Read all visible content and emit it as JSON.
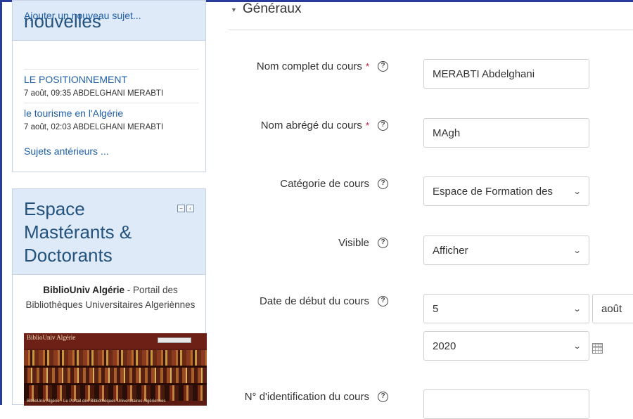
{
  "news_block": {
    "title": "nouvelles",
    "add_topic": "Ajouter un nouveau sujet...",
    "posts": [
      {
        "title": "LE POSITIONNEMENT",
        "meta": "7 août, 09:35  ABDELGHANI MERABTI"
      },
      {
        "title": "le tourisme en l'Algérie",
        "meta": "7 août, 02:03  ABDELGHANI MERABTI"
      }
    ],
    "older": "Sujets antérieurs ..."
  },
  "espace_block": {
    "title": "Espace Mastérants & Doctorants",
    "biblio_name": "BiblioUniv Algérie",
    "biblio_desc": " - Portail des Bibliothèques Universitaires Algeriènnes",
    "image_logo": "BiblioUniv Algérie",
    "image_caption": "BiblioUniv Algérie - Le Portail des Bibliothèques Universitaires Algériennes"
  },
  "section": {
    "title": "Généraux"
  },
  "form": {
    "fullname": {
      "label": "Nom complet du cours",
      "value": "MERABTI Abdelghani"
    },
    "shortname": {
      "label": "Nom abrégé du cours",
      "value": "MAgh"
    },
    "category": {
      "label": "Catégorie de cours",
      "value": "Espace de Formation des"
    },
    "visible": {
      "label": "Visible",
      "value": "Afficher"
    },
    "startdate": {
      "label": "Date de début du cours",
      "day": "5",
      "month": "août",
      "year": "2020"
    },
    "idnumber": {
      "label": "N° d'identification du cours",
      "value": ""
    }
  },
  "icons": {
    "help": "?",
    "required": "*",
    "chevron": "⌄",
    "caret": "▼"
  },
  "colors": {
    "block_header_bg": "#dfeaf8",
    "link": "#1f5fa8",
    "required": "#c8102e",
    "frame": "#2a3c9a"
  }
}
